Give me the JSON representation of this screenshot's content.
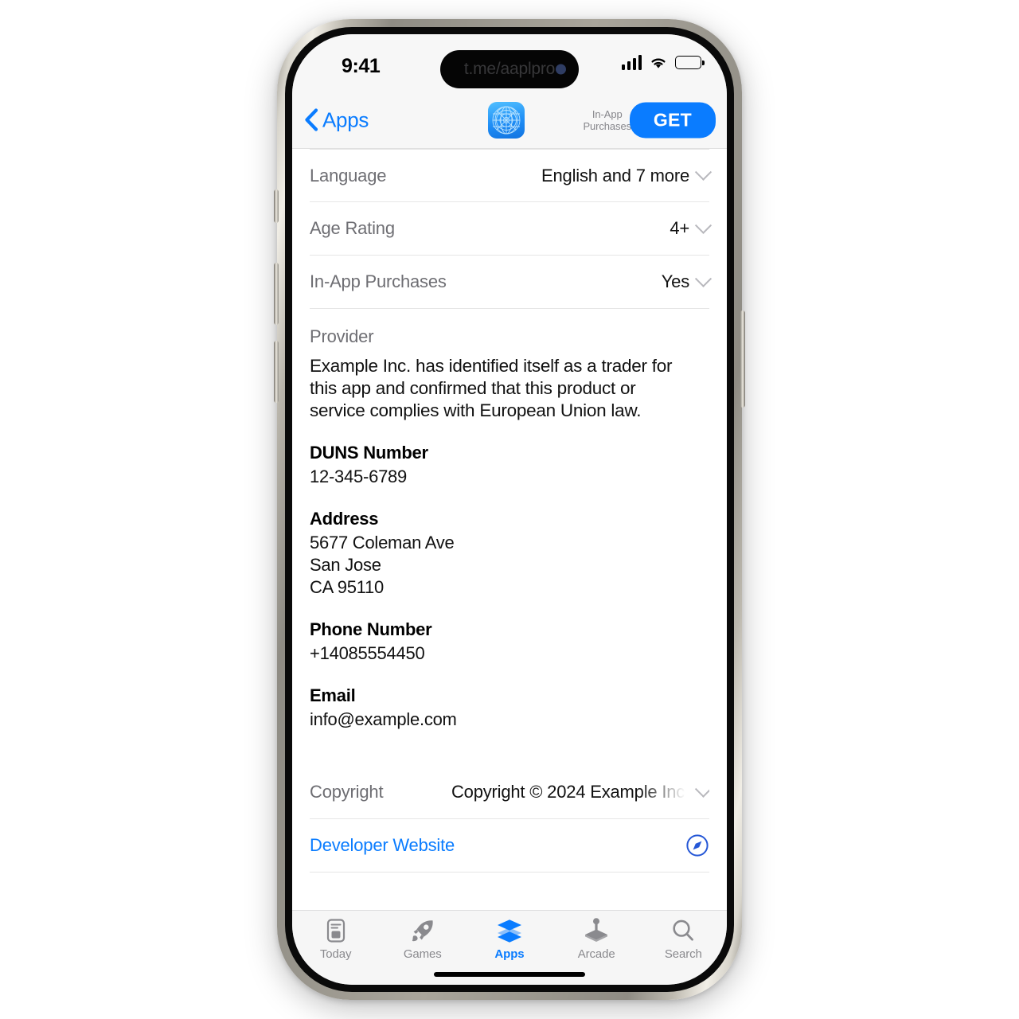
{
  "status_bar": {
    "time": "9:41",
    "island_text": "t.me/aaplpro",
    "signal_icon": "cellular-signal-icon",
    "wifi_icon": "wifi-icon",
    "battery_icon": "battery-full-icon"
  },
  "nav_bar": {
    "back_label": "Apps",
    "back_icon": "chevron-left-icon",
    "app_icon": "app-icon",
    "iap_line1": "In-App",
    "iap_line2": "Purchases",
    "get_label": "GET"
  },
  "info_rows": [
    {
      "label": "Language",
      "value": "English and 7 more"
    },
    {
      "label": "Age Rating",
      "value": "4+"
    },
    {
      "label": "In-App Purchases",
      "value": "Yes"
    }
  ],
  "provider": {
    "title": "Provider",
    "statement": "Example Inc. has identified itself as a trader for this app and confirmed that this product or service complies with European Union law.",
    "details": [
      {
        "heading": "DUNS Number",
        "lines": [
          "12-345-6789"
        ]
      },
      {
        "heading": "Address",
        "lines": [
          "5677 Coleman Ave",
          "San Jose",
          "CA 95110"
        ]
      },
      {
        "heading": "Phone Number",
        "lines": [
          "+14085554450"
        ]
      },
      {
        "heading": "Email",
        "lines": [
          "info@example.com"
        ]
      }
    ]
  },
  "copyright_row": {
    "label": "Copyright",
    "value": "Copyright © 2024 Example Inc."
  },
  "developer_website_row": {
    "label": "Developer Website",
    "icon": "safari-compass-icon"
  },
  "tab_bar": {
    "tabs": [
      {
        "label": "Today",
        "icon": "today-document-icon",
        "active": false
      },
      {
        "label": "Games",
        "icon": "rocket-icon",
        "active": false
      },
      {
        "label": "Apps",
        "icon": "stacked-layers-icon",
        "active": true
      },
      {
        "label": "Arcade",
        "icon": "joystick-icon",
        "active": false
      },
      {
        "label": "Search",
        "icon": "magnifier-icon",
        "active": false
      }
    ]
  },
  "colors": {
    "accent_blue": "#0a7cff",
    "label_gray": "#6e6e73",
    "tab_inactive": "#8a8a8e"
  }
}
